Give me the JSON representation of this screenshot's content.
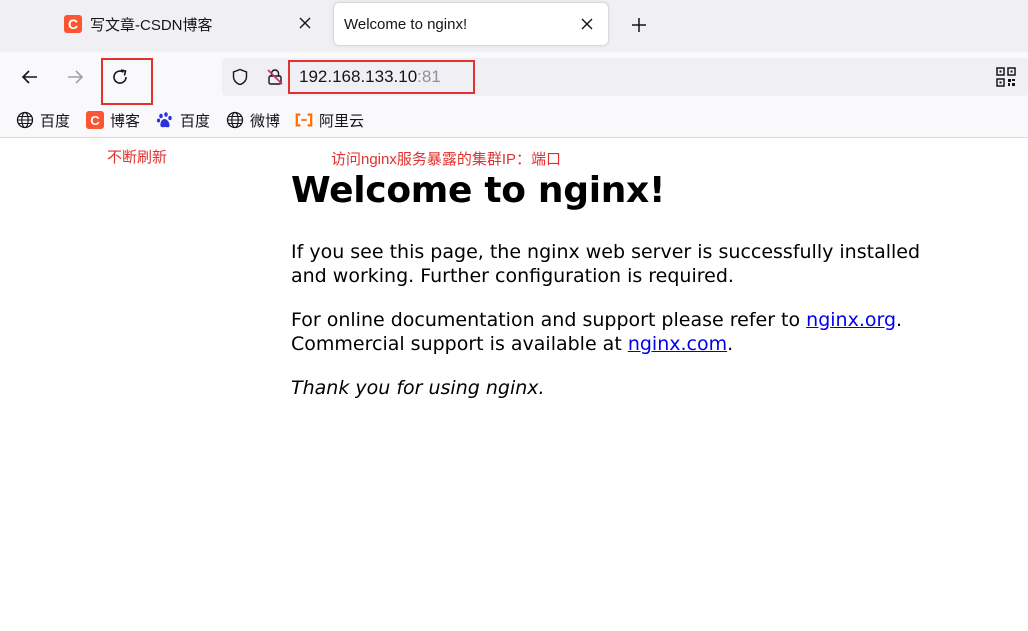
{
  "tabs": [
    {
      "title": "写文章-CSDN博客",
      "favicon": "csdn-icon",
      "active": false
    },
    {
      "title": "Welcome to nginx!",
      "active": true
    }
  ],
  "nav": {
    "back": "back-arrow-icon",
    "forward": "forward-arrow-icon",
    "reload": "reload-icon"
  },
  "urlbar": {
    "host": "192.168.133.10",
    "port": ":81"
  },
  "bookmarks": [
    {
      "label": "百度",
      "icon": "globe-icon"
    },
    {
      "label": "博客",
      "icon": "csdn-icon"
    },
    {
      "label": "百度",
      "icon": "baidu-paw-icon"
    },
    {
      "label": "微博",
      "icon": "globe-icon"
    },
    {
      "label": "阿里云",
      "icon": "aliyun-icon"
    }
  ],
  "annotations": {
    "refresh_note": "不断刷新",
    "address_note": "访问nginx服务暴露的集群IP：端口"
  },
  "page": {
    "heading": "Welcome to nginx!",
    "p1": "If you see this page, the nginx web server is successfully installed and working. Further configuration is required.",
    "p2_prefix": "For online documentation and support please refer to ",
    "p2_link1": "nginx.org",
    "p2_mid": ".",
    "p2_line2": "Commercial support is available at ",
    "p2_link2": "nginx.com",
    "p2_end": ".",
    "thanks": "Thank you for using nginx."
  },
  "colors": {
    "annotation_red": "#e0322f",
    "link_blue": "#0000ee",
    "csdn_orange": "#fc5531"
  }
}
